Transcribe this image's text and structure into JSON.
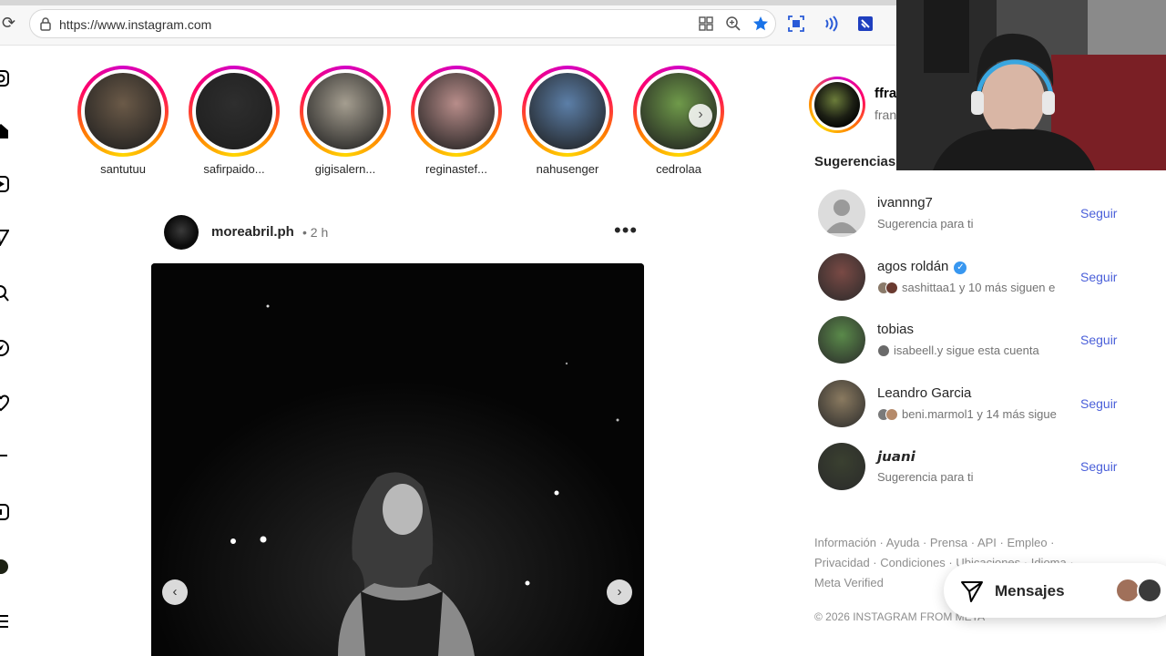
{
  "browser": {
    "url": "https://www.instagram.com"
  },
  "stories": [
    {
      "name": "santutuu",
      "color": "#6b5a48"
    },
    {
      "name": "safirpaido...",
      "color": "#2e2e2e"
    },
    {
      "name": "gigisalern...",
      "color": "#a59e90"
    },
    {
      "name": "reginastef...",
      "color": "#b88d8a"
    },
    {
      "name": "nahusenger",
      "color": "#5c7fa8"
    },
    {
      "name": "cedrolaa",
      "color": "#6f9a4a"
    }
  ],
  "post": {
    "username": "moreabril.ph",
    "time": "• 2 h"
  },
  "current_user": {
    "username": "ffra",
    "name": "fran"
  },
  "suggestions": {
    "title": "Sugerencias p",
    "follow_label": "Seguir",
    "items": [
      {
        "name": "ivannng7",
        "sub": "Sugerencia para ti",
        "verified": false,
        "avatar_color": "#d4d4d4",
        "mini": []
      },
      {
        "name": "agos roldán",
        "sub": "sashittaa1 y 10 más siguen e",
        "verified": true,
        "avatar_color": "#7a4a45",
        "mini": [
          "#8a7a6a",
          "#6a3a30"
        ]
      },
      {
        "name": "tobias",
        "sub": "isabeell.y sigue esta cuenta",
        "verified": false,
        "avatar_color": "#5a8a4a",
        "mini": [
          "#6a6a6a"
        ]
      },
      {
        "name": "Leandro Garcia",
        "sub": "beni.marmol1 y 14 más sigue",
        "verified": false,
        "avatar_color": "#8a7a60",
        "mini": [
          "#7a7a7a",
          "#b58a6a"
        ]
      },
      {
        "name": "𝙟𝙪𝙖𝙣𝙞",
        "sub": "Sugerencia para ti",
        "verified": false,
        "avatar_color": "#3a4030",
        "mini": []
      }
    ]
  },
  "footer": {
    "links": "Información · Ayuda · Prensa · API · Empleo · Privacidad · Condiciones · Ubicaciones · Idioma · Meta Verified",
    "copyright": "© 2026 INSTAGRAM FROM META"
  },
  "messages": {
    "label": "Mensajes"
  }
}
